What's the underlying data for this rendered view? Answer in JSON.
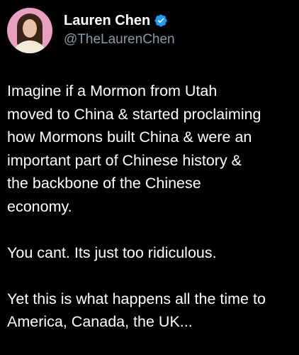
{
  "author": {
    "display_name": "Lauren Chen",
    "handle": "@TheLaurenChen",
    "verified_icon": "verified-badge-icon",
    "avatar": "avatar-photo"
  },
  "tweet": {
    "paragraphs": [
      {
        "lines": [
          "Imagine if a Mormon from Utah",
          "moved to China & started proclaiming",
          "how Mormons built China & were an",
          "important part of Chinese history &",
          "the backbone of the Chinese",
          "economy."
        ]
      },
      {
        "lines": [
          "You cant. Its just too ridiculous."
        ]
      },
      {
        "lines": [
          "Yet this is what happens all the time to",
          "America, Canada, the UK..."
        ]
      }
    ]
  },
  "colors": {
    "background": "#000000",
    "text": "#ffffff",
    "handle": "#8b98a5",
    "verified": "#1d9bf0"
  }
}
